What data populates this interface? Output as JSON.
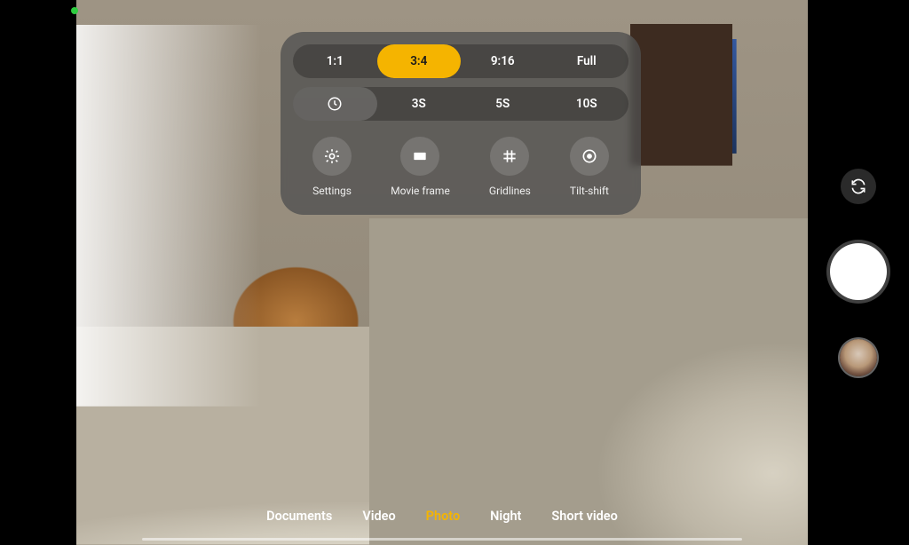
{
  "aspect_ratio": {
    "options": [
      "1:1",
      "3:4",
      "9:16",
      "Full"
    ],
    "selected_index": 1
  },
  "timer": {
    "options_labels": [
      "",
      "3S",
      "5S",
      "10S"
    ],
    "icon_name": "timer-icon",
    "selected_index": 0
  },
  "tools": [
    {
      "label": "Settings",
      "icon": "gear-icon"
    },
    {
      "label": "Movie frame",
      "icon": "movie-frame-icon"
    },
    {
      "label": "Gridlines",
      "icon": "grid-icon"
    },
    {
      "label": "Tilt-shift",
      "icon": "tilt-shift-icon"
    }
  ],
  "modes": {
    "options": [
      "Documents",
      "Video",
      "Photo",
      "Night",
      "Short video"
    ],
    "selected_index": 2
  },
  "right_controls": {
    "switch_camera_icon": "switch-camera-icon",
    "shutter": "shutter-button",
    "gallery_thumb": "gallery-thumbnail"
  },
  "colors": {
    "accent": "#f5b400"
  }
}
